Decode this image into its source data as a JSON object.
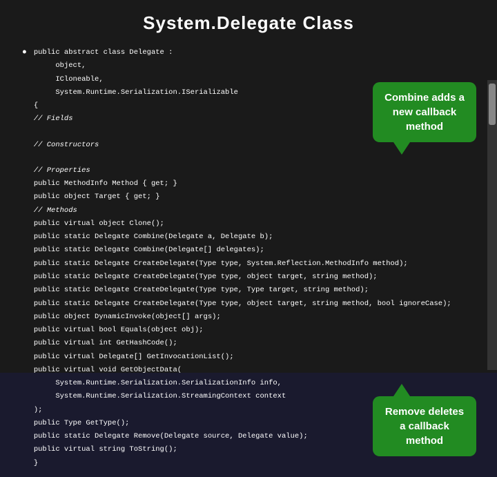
{
  "slide": {
    "title": "System.Delegate Class",
    "code": {
      "class_declaration": "public abstract class Delegate :\n     object,\n     ICloneable,\n     System.Runtime.Serialization.ISerializable\n{",
      "fields_comment": "// Fields",
      "constructors_comment": "// Constructors",
      "properties_comment": "// Properties",
      "properties_code": "public MethodInfo Method { get; }\npublic object Target { get; }",
      "methods_comment": "// Methods",
      "methods_code": "public virtual object Clone();\npublic static Delegate Combine(Delegate a, Delegate b);\npublic static Delegate Combine(Delegate[] delegates);\npublic static Delegate CreateDelegate(Type type, System.Reflection.MethodInfo method);\npublic static Delegate CreateDelegate(Type type, object target, string method);\npublic static Delegate CreateDelegate(Type type, Type target, string method);\npublic static Delegate CreateDelegate(Type type, object target, string method, bool ignoreCase);\npublic object DynamicInvoke(object[] args);\npublic virtual bool Equals(object obj);\npublic virtual int GetHashCode();\npublic virtual Delegate[] GetInvocationList();\npublic virtual void GetObjectData(\n     System.Runtime.Serialization.SerializationInfo info,\n     System.Runtime.Serialization.StreamingContext context\n);\npublic Type GetType();\npublic static Delegate Remove(Delegate source, Delegate value);\npublic virtual string ToString();\n}"
    },
    "callout_top": {
      "text": "Combine adds a new callback method"
    },
    "callout_bottom": {
      "text": "Remove deletes a callback method"
    }
  }
}
